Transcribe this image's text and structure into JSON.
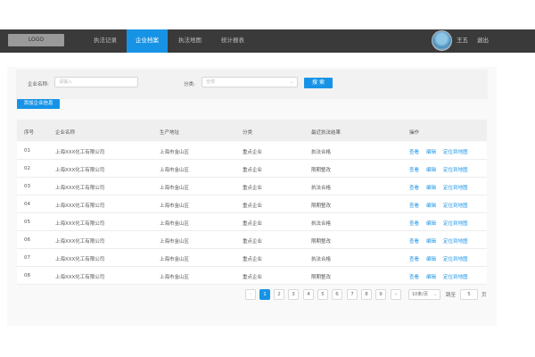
{
  "header": {
    "logo": "LOGO",
    "nav": [
      {
        "label": "执法记录",
        "active": false
      },
      {
        "label": "企业档案",
        "active": true
      },
      {
        "label": "执法地图",
        "active": false
      },
      {
        "label": "统计报表",
        "active": false
      }
    ],
    "user_name": "王五",
    "logout": "退出"
  },
  "filters": {
    "company_label": "企业名称:",
    "company_placeholder": "请输入",
    "category_label": "分类:",
    "category_value": "全部",
    "search_button": "搜 索",
    "add_button": "添加企业信息"
  },
  "table": {
    "columns": [
      "序号",
      "企业名称",
      "生产地址",
      "分类",
      "最近执法结果",
      "操作"
    ],
    "rows": [
      {
        "no": "01",
        "name": "上海XXX化工有限公司",
        "address": "上海市金山区",
        "category": "重点企业",
        "result": "执法合格"
      },
      {
        "no": "02",
        "name": "上海XXX化工有限公司",
        "address": "上海市金山区",
        "category": "重点企业",
        "result": "限期整改"
      },
      {
        "no": "03",
        "name": "上海XXX化工有限公司",
        "address": "上海市金山区",
        "category": "重点企业",
        "result": "执法合格"
      },
      {
        "no": "04",
        "name": "上海XXX化工有限公司",
        "address": "上海市金山区",
        "category": "重点企业",
        "result": "限期整改"
      },
      {
        "no": "05",
        "name": "上海XXX化工有限公司",
        "address": "上海市金山区",
        "category": "重点企业",
        "result": "执法合格"
      },
      {
        "no": "06",
        "name": "上海XXX化工有限公司",
        "address": "上海市金山区",
        "category": "重点企业",
        "result": "限期整改"
      },
      {
        "no": "07",
        "name": "上海XXX化工有限公司",
        "address": "上海市金山区",
        "category": "重点企业",
        "result": "执法合格"
      },
      {
        "no": "08",
        "name": "上海XXX化工有限公司",
        "address": "上海市金山区",
        "category": "重点企业",
        "result": "限期整改"
      }
    ],
    "actions": [
      "查看",
      "编辑",
      "定位到地图"
    ]
  },
  "pagination": {
    "prev": "‹",
    "next": "›",
    "pages": [
      "1",
      "2",
      "3",
      "4",
      "5",
      "6",
      "7",
      "8",
      "9"
    ],
    "current": "1",
    "page_size": "10条/页",
    "jump_label": "跳至",
    "jump_value": "5",
    "page_unit": "页"
  },
  "colors": {
    "accent": "#1793e6",
    "nav_bg": "#3a3a3a"
  }
}
